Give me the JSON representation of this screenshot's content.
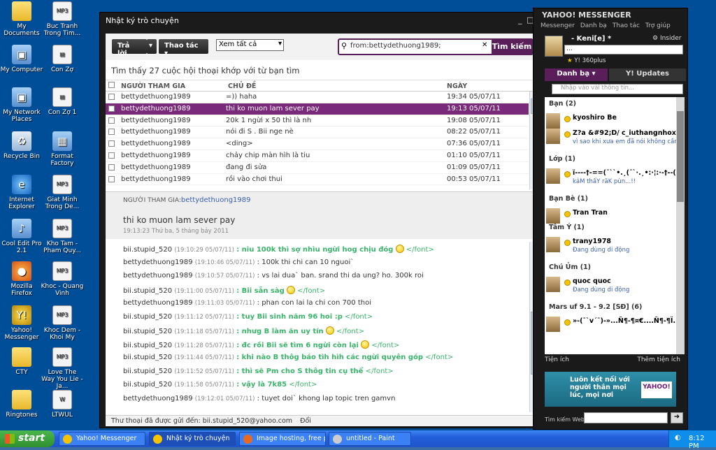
{
  "desktop": {
    "icons": [
      {
        "label": "My Documents",
        "icon": "folder-icon"
      },
      {
        "label": "My Computer",
        "icon": "computer-icon"
      },
      {
        "label": "My Network Places",
        "icon": "network-icon"
      },
      {
        "label": "Recycle Bin",
        "icon": "recycle-bin-icon"
      },
      {
        "label": "Internet Explorer",
        "icon": "ie-icon"
      },
      {
        "label": "Cool Edit Pro 2.1",
        "icon": "audio-app-icon"
      },
      {
        "label": "Mozilla Firefox",
        "icon": "firefox-icon"
      },
      {
        "label": "Yahoo! Messenger",
        "icon": "yahoo-icon"
      },
      {
        "label": "CTY",
        "icon": "folder-icon"
      },
      {
        "label": "Ringtones",
        "icon": "folder-icon"
      },
      {
        "label": "Buc Tranh Trong Tim...",
        "icon": "mp3-icon"
      },
      {
        "label": "Con Zợ",
        "icon": "file-icon"
      },
      {
        "label": "Con Zợ 1",
        "icon": "file-icon"
      },
      {
        "label": "Format Factory",
        "icon": "app-icon"
      },
      {
        "label": "Giat Minh Trong De...",
        "icon": "mp3-icon"
      },
      {
        "label": "Kho Tam - Pham Quy...",
        "icon": "mp3-icon"
      },
      {
        "label": "Khoc - Quang Vinh",
        "icon": "mp3-icon"
      },
      {
        "label": "Khoc Dem - Khoi My",
        "icon": "mp3-icon"
      },
      {
        "label": "Love The Way You Lie - Ja...",
        "icon": "mp3-icon"
      },
      {
        "label": "LTWUL",
        "icon": "word-icon"
      }
    ]
  },
  "history": {
    "title": "Nhật ký trò chuyện",
    "reply_label": "Trả lời",
    "action_label": "Thao tác",
    "filter_value": "Xem tất cả",
    "search_value": "from:bettydethuong1989;",
    "search_button": "Tìm kiếm",
    "result_text": "Tìm thấy 27 cuộc hội thoại khớp với từ bạn tìm",
    "columns": {
      "participant": "NGƯỜI THAM GIA",
      "subject": "CHỦ ĐỀ",
      "date": "NGÀY"
    },
    "rows": [
      {
        "participant": "bettydethuong1989",
        "subject": "=)) haha",
        "date": "19:34 05/07/11",
        "selected": false
      },
      {
        "participant": "bettydethuong1989",
        "subject": "thi ko muon lam sever pay",
        "date": "19:13 05/07/11",
        "selected": true
      },
      {
        "participant": "bettydethuong1989",
        "subject": "20k 1 ngừi x 50 thì là nh",
        "date": "19:08 05/07/11",
        "selected": false
      },
      {
        "participant": "bettydethuong1989",
        "subject": "nói đi S . Bii nge nè",
        "date": "08:22 05/07/11",
        "selected": false
      },
      {
        "participant": "bettydethuong1989",
        "subject": "<ding>",
        "date": "07:36 05/07/11",
        "selected": false
      },
      {
        "participant": "bettydethuong1989",
        "subject": "chảy chip màn hìh là tiu",
        "date": "01:10 05/07/11",
        "selected": false
      },
      {
        "participant": "bettydethuong1989",
        "subject": "đang đi sửa",
        "date": "01:09 05/07/11",
        "selected": false
      },
      {
        "participant": "bettydethuong1989",
        "subject": "rồi vào chơi thui",
        "date": "00:53 05/07/11",
        "selected": false
      }
    ],
    "participants_label": "NGƯỜI THAM GIA:",
    "participants_value": "bettydethuong1989",
    "conversation_subject": "thi ko muon lam sever pay",
    "conversation_date": "19:13:23 Thứ ba, 5 tháng bảy 2011",
    "messages": [
      {
        "sender": "bii.stupid_520",
        "time": "(19:10:29 05/07/11)",
        "text": ": niu 100k thì sợ nhìu ngừi hog chịu đóg",
        "green": true,
        "smile": true,
        "tag": "</font>"
      },
      {
        "sender": "bettydethuong1989",
        "time": "(19:10:46 05/07/11)",
        "text": ": 100k thi chi can 10 nguoi`",
        "green": false,
        "smile": false,
        "tag": ""
      },
      {
        "sender": "bettydethuong1989",
        "time": "(19:10:57 05/07/11)",
        "text": ": vs lai dua` ban. srand thi da ung? ho. 300k roi",
        "green": false,
        "smile": false,
        "tag": ""
      },
      {
        "sender": "bii.stupid_520",
        "time": "(19:11:00 05/07/11)",
        "text": ": Bii sẵn sàg",
        "green": true,
        "smile": true,
        "tag": "</font>"
      },
      {
        "sender": "bettydethuong1989",
        "time": "(19:11:03 05/07/11)",
        "text": ": phan con lai la chi con 700 thoi",
        "green": false,
        "smile": false,
        "tag": ""
      },
      {
        "sender": "bii.stupid_520",
        "time": "(19:11:12 05/07/11)",
        "text": ": tuy Bii sinh năm 96 hoi :p",
        "green": true,
        "smile": false,
        "tag": "</font>"
      },
      {
        "sender": "bii.stupid_520",
        "time": "(19:11:18 05/07/11)",
        "text": ":  nhưg B làm ăn uy tín",
        "green": true,
        "smile": true,
        "tag": "</font>"
      },
      {
        "sender": "bii.stupid_520",
        "time": "(19:11:28 05/07/11)",
        "text": ": đc rồi Bii sẽ tìm 6 ngừi còn lại",
        "green": true,
        "smile": true,
        "tag": "</font>"
      },
      {
        "sender": "bii.stupid_520",
        "time": "(19:11:44 05/07/11)",
        "text": ": khi nào B thôg báo tìh hìh các ngừi quyên góp",
        "green": true,
        "smile": false,
        "tag": "</font>"
      },
      {
        "sender": "bii.stupid_520",
        "time": "(19:11:52 05/07/11)",
        "text": ": thì sẽ Pm cho S thôg tin cụ thể",
        "green": true,
        "smile": false,
        "tag": "</font>"
      },
      {
        "sender": "bii.stupid_520",
        "time": "(19:11:58 05/07/11)",
        "text": ": vậy là 7k85",
        "green": true,
        "smile": false,
        "tag": "</font>"
      },
      {
        "sender": "bettydethuong1989",
        "time": "(19:12:01 05/07/11)",
        "text": ": tuyet doi` khong lap topic tren gamvn",
        "green": false,
        "smile": false,
        "tag": ""
      }
    ],
    "footer": "Thư thoại đã được gửi đến: bii.stupid_520@yahoo.com",
    "footer_link": "Đổi"
  },
  "messenger": {
    "title": "YAHOO! MESSENGER",
    "menu": [
      "Messenger",
      "Danh bạ",
      "Thao tác",
      "Trợ giúp"
    ],
    "user_name": "- Keni[e] *",
    "insider": "Insider",
    "status_value": "...",
    "sub_status": "Y! 360plus",
    "tab_contacts": "Danh bạ",
    "tab_updates": "Y! Updates",
    "search_placeholder": "Nhập vào vài thông tin...",
    "groups": [
      {
        "label": "Bạn (2)",
        "buddies": [
          {
            "name": "kyoshiro Be",
            "status": ""
          },
          {
            "name": "Z?a &#92;D/ c_iuthangnhox",
            "status": "vì sao khi xưa em đã nói không cần..."
          }
        ]
      },
      {
        "label": "Lớp (1)",
        "buddies": [
          {
            "name": "ï----†-==(¯``•.¸(¯`·.¸•:·¦:·-†--(...",
            "status": "kảM thấY rãK pùn...!!"
          }
        ]
      },
      {
        "label": "Bạn Bè (1)",
        "buddies": [
          {
            "name": "Tran Tran",
            "status": ""
          }
        ]
      },
      {
        "label": "Tâm Ý (1)",
        "buddies": [
          {
            "name": "trany1978",
            "status": "Đang dùng di động"
          }
        ]
      },
      {
        "label": "Chú Ủm (1)",
        "buddies": [
          {
            "name": "quoc quoc",
            "status": "Đang dùng di động"
          }
        ]
      },
      {
        "label": "Mars uf 9.1 - 9.2 [SĐ] (6)",
        "buddies": [
          {
            "name": "»-(¯`v´¯)-»...Ñ¶-¶¤€....Ñ¶-¶Ï...",
            "status": ""
          }
        ]
      }
    ],
    "plugin_label": "Tiện ích",
    "add_plugin_label": "Thêm tiện ích",
    "ad_text": "Luôn kết nối với người thân mọi lúc, mọi nơi",
    "ad_logo": "YAHOO!",
    "web_search_label": "Tìm kiếm Web"
  },
  "taskbar": {
    "start": "start",
    "tasks": [
      "Yahoo! Messenger",
      "Nhật ký trò chuyện",
      "Image hosting, free p...",
      "untitled - Paint"
    ],
    "clock": "8:12 PM"
  }
}
